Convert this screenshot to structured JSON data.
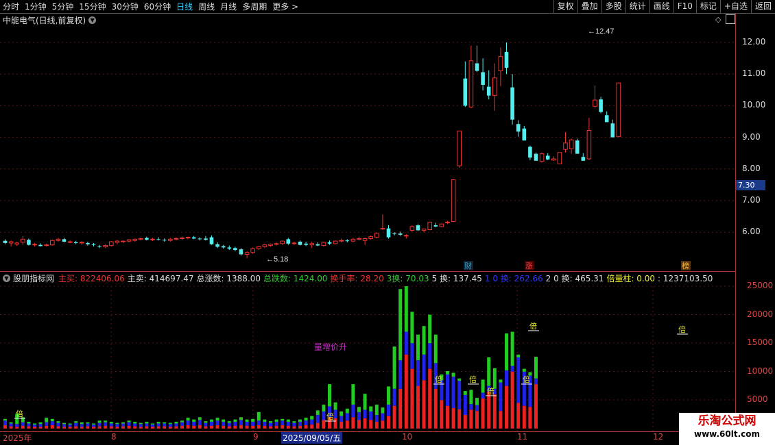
{
  "toolbar": {
    "tabs": [
      {
        "label": "分时",
        "active": false
      },
      {
        "label": "1分钟",
        "active": false
      },
      {
        "label": "5分钟",
        "active": false
      },
      {
        "label": "15分钟",
        "active": false
      },
      {
        "label": "30分钟",
        "active": false
      },
      {
        "label": "60分钟",
        "active": false
      },
      {
        "label": "日线",
        "active": true
      },
      {
        "label": "周线",
        "active": false
      },
      {
        "label": "月线",
        "active": false
      },
      {
        "label": "多周期",
        "active": false
      },
      {
        "label": "更多 >",
        "active": false
      }
    ],
    "right_buttons": [
      "复权",
      "叠加",
      "多股",
      "统计",
      "画线",
      "F10",
      "标记",
      "+自选",
      "返回"
    ]
  },
  "chart_title": "中能电气(日线,前复权)",
  "price_axis": [
    "12.00",
    "11.00",
    "10.00",
    "9.00",
    "8.00",
    "7.00",
    "6.00"
  ],
  "current_price": "7.30",
  "high_label": "12.47",
  "low_label": "5.18",
  "event_markers": [
    {
      "text": "财",
      "color": "#3ad"
    },
    {
      "text": "涨",
      "color": "#e44"
    },
    {
      "text": "榜",
      "color": "#fb3"
    }
  ],
  "indicator": {
    "name": "股朋指标网",
    "fields": [
      {
        "label": "主买: ",
        "value": "822406.06",
        "color": "#e33"
      },
      {
        "label": "主卖: ",
        "value": "414697.47",
        "color": "#ddd"
      },
      {
        "label": "总涨数: ",
        "value": "1388.00",
        "color": "#ddd"
      },
      {
        "label": "总跌数: ",
        "value": "1424.00",
        "color": "#3c3"
      },
      {
        "label": "换手率: ",
        "value": "28.20",
        "color": "#e33"
      },
      {
        "label": "3换: ",
        "value": "70.03",
        "color": "#3c3"
      },
      {
        "label": "5 换: ",
        "value": "137.45",
        "color": "#ddd"
      },
      {
        "label": "1 0 换: ",
        "value": "262.66",
        "color": "#33f"
      },
      {
        "label": "2 0 换: ",
        "value": "465.31",
        "color": "#ddd"
      },
      {
        "label": "倍量柱: ",
        "value": "0.00",
        "color": "#ee3"
      },
      {
        "label": ": ",
        "value": "1237103.50",
        "color": "#ddd"
      }
    ],
    "annotation": "量增价升",
    "bei_label": "倍"
  },
  "volume_axis": [
    "25000",
    "20000",
    "15000",
    "10000",
    "5000"
  ],
  "date_axis": [
    "2025年",
    "8",
    "9",
    "2025/09/05/五",
    "10",
    "11",
    "12"
  ],
  "watermark": {
    "line1": "乐淘公式网",
    "line2": "www.60lt.com"
  },
  "chart_data": {
    "type": "candlestick",
    "candles": [
      {
        "o": 5.73,
        "h": 5.78,
        "l": 5.62,
        "c": 5.66
      },
      {
        "o": 5.66,
        "h": 5.74,
        "l": 5.55,
        "c": 5.7
      },
      {
        "o": 5.62,
        "h": 5.7,
        "l": 5.57,
        "c": 5.66
      },
      {
        "o": 5.68,
        "h": 5.88,
        "l": 5.6,
        "c": 5.78
      },
      {
        "o": 5.76,
        "h": 5.8,
        "l": 5.58,
        "c": 5.6
      },
      {
        "o": 5.6,
        "h": 5.66,
        "l": 5.55,
        "c": 5.62
      },
      {
        "o": 5.6,
        "h": 5.65,
        "l": 5.55,
        "c": 5.56
      },
      {
        "o": 5.58,
        "h": 5.64,
        "l": 5.55,
        "c": 5.6
      },
      {
        "o": 5.6,
        "h": 5.76,
        "l": 5.58,
        "c": 5.74
      },
      {
        "o": 5.74,
        "h": 5.82,
        "l": 5.7,
        "c": 5.78
      },
      {
        "o": 5.78,
        "h": 5.82,
        "l": 5.68,
        "c": 5.7
      },
      {
        "o": 5.7,
        "h": 5.74,
        "l": 5.65,
        "c": 5.7
      },
      {
        "o": 5.68,
        "h": 5.73,
        "l": 5.62,
        "c": 5.66
      },
      {
        "o": 5.66,
        "h": 5.72,
        "l": 5.6,
        "c": 5.68
      },
      {
        "o": 5.66,
        "h": 5.7,
        "l": 5.58,
        "c": 5.62
      },
      {
        "o": 5.62,
        "h": 5.66,
        "l": 5.55,
        "c": 5.6
      },
      {
        "o": 5.56,
        "h": 5.6,
        "l": 5.5,
        "c": 5.54
      },
      {
        "o": 5.54,
        "h": 5.62,
        "l": 5.5,
        "c": 5.58
      },
      {
        "o": 5.58,
        "h": 5.72,
        "l": 5.55,
        "c": 5.7
      },
      {
        "o": 5.68,
        "h": 5.75,
        "l": 5.62,
        "c": 5.72
      },
      {
        "o": 5.7,
        "h": 5.74,
        "l": 5.66,
        "c": 5.72
      },
      {
        "o": 5.72,
        "h": 5.78,
        "l": 5.68,
        "c": 5.76
      },
      {
        "o": 5.74,
        "h": 5.8,
        "l": 5.7,
        "c": 5.78
      },
      {
        "o": 5.78,
        "h": 5.83,
        "l": 5.74,
        "c": 5.8
      },
      {
        "o": 5.82,
        "h": 5.86,
        "l": 5.74,
        "c": 5.76
      },
      {
        "o": 5.76,
        "h": 5.82,
        "l": 5.72,
        "c": 5.78
      },
      {
        "o": 5.78,
        "h": 5.84,
        "l": 5.74,
        "c": 5.76
      },
      {
        "o": 5.76,
        "h": 5.8,
        "l": 5.7,
        "c": 5.74
      },
      {
        "o": 5.74,
        "h": 5.82,
        "l": 5.7,
        "c": 5.78
      },
      {
        "o": 5.78,
        "h": 5.84,
        "l": 5.74,
        "c": 5.8
      },
      {
        "o": 5.8,
        "h": 5.86,
        "l": 5.76,
        "c": 5.82
      },
      {
        "o": 5.82,
        "h": 5.86,
        "l": 5.78,
        "c": 5.84
      },
      {
        "o": 5.84,
        "h": 5.88,
        "l": 5.78,
        "c": 5.8
      },
      {
        "o": 5.8,
        "h": 5.84,
        "l": 5.74,
        "c": 5.78
      },
      {
        "o": 5.8,
        "h": 5.88,
        "l": 5.74,
        "c": 5.76
      },
      {
        "o": 5.84,
        "h": 5.9,
        "l": 5.6,
        "c": 5.62
      },
      {
        "o": 5.62,
        "h": 5.68,
        "l": 5.5,
        "c": 5.54
      },
      {
        "o": 5.56,
        "h": 5.6,
        "l": 5.48,
        "c": 5.52
      },
      {
        "o": 5.52,
        "h": 5.58,
        "l": 5.44,
        "c": 5.48
      },
      {
        "o": 5.5,
        "h": 5.54,
        "l": 5.4,
        "c": 5.44
      },
      {
        "o": 5.46,
        "h": 5.5,
        "l": 5.26,
        "c": 5.3
      },
      {
        "o": 5.3,
        "h": 5.4,
        "l": 5.18,
        "c": 5.36
      },
      {
        "o": 5.36,
        "h": 5.52,
        "l": 5.32,
        "c": 5.48
      },
      {
        "o": 5.48,
        "h": 5.56,
        "l": 5.44,
        "c": 5.54
      },
      {
        "o": 5.54,
        "h": 5.62,
        "l": 5.5,
        "c": 5.6
      },
      {
        "o": 5.58,
        "h": 5.64,
        "l": 5.54,
        "c": 5.62
      },
      {
        "o": 5.62,
        "h": 5.68,
        "l": 5.58,
        "c": 5.64
      },
      {
        "o": 5.64,
        "h": 5.74,
        "l": 5.6,
        "c": 5.72
      },
      {
        "o": 5.78,
        "h": 5.82,
        "l": 5.6,
        "c": 5.64
      },
      {
        "o": 5.64,
        "h": 5.7,
        "l": 5.6,
        "c": 5.66
      },
      {
        "o": 5.7,
        "h": 5.74,
        "l": 5.58,
        "c": 5.6
      },
      {
        "o": 5.64,
        "h": 5.7,
        "l": 5.56,
        "c": 5.6
      },
      {
        "o": 5.6,
        "h": 5.7,
        "l": 5.5,
        "c": 5.64
      },
      {
        "o": 5.62,
        "h": 5.68,
        "l": 5.56,
        "c": 5.58
      },
      {
        "o": 5.58,
        "h": 5.7,
        "l": 5.55,
        "c": 5.68
      },
      {
        "o": 5.68,
        "h": 5.74,
        "l": 5.6,
        "c": 5.64
      },
      {
        "o": 5.64,
        "h": 5.74,
        "l": 5.62,
        "c": 5.72
      },
      {
        "o": 5.72,
        "h": 5.8,
        "l": 5.68,
        "c": 5.74
      },
      {
        "o": 5.74,
        "h": 5.78,
        "l": 5.68,
        "c": 5.72
      },
      {
        "o": 5.72,
        "h": 5.82,
        "l": 5.68,
        "c": 5.78
      },
      {
        "o": 5.78,
        "h": 5.86,
        "l": 5.74,
        "c": 5.8
      },
      {
        "o": 5.74,
        "h": 5.82,
        "l": 5.6,
        "c": 5.8
      },
      {
        "o": 5.8,
        "h": 5.9,
        "l": 5.76,
        "c": 5.86
      },
      {
        "o": 5.84,
        "h": 6.0,
        "l": 5.8,
        "c": 5.96
      },
      {
        "o": 6.12,
        "h": 6.56,
        "l": 6.08,
        "c": 6.12
      },
      {
        "o": 6.12,
        "h": 6.22,
        "l": 5.8,
        "c": 5.84
      },
      {
        "o": 5.96,
        "h": 6.0,
        "l": 5.9,
        "c": 5.94
      },
      {
        "o": 5.96,
        "h": 6.02,
        "l": 5.88,
        "c": 5.92
      },
      {
        "o": 5.9,
        "h": 5.94,
        "l": 5.8,
        "c": 5.9
      },
      {
        "o": 6.06,
        "h": 6.22,
        "l": 6.02,
        "c": 6.18
      },
      {
        "o": 6.22,
        "h": 6.26,
        "l": 6.04,
        "c": 6.06
      },
      {
        "o": 6.06,
        "h": 6.12,
        "l": 6.0,
        "c": 6.1
      },
      {
        "o": 6.08,
        "h": 6.34,
        "l": 6.06,
        "c": 6.32
      },
      {
        "o": 6.22,
        "h": 6.3,
        "l": 6.16,
        "c": 6.18
      },
      {
        "o": 6.18,
        "h": 6.28,
        "l": 6.16,
        "c": 6.26
      },
      {
        "o": 6.3,
        "h": 6.36,
        "l": 6.26,
        "c": 6.32
      },
      {
        "o": 6.34,
        "h": 7.66,
        "l": 6.34,
        "c": 7.66
      },
      {
        "o": 8.1,
        "h": 8.24,
        "l": 8.04,
        "c": 9.2
      },
      {
        "o": 10.86,
        "h": 11.4,
        "l": 9.96,
        "c": 10.0
      },
      {
        "o": 9.96,
        "h": 11.9,
        "l": 9.92,
        "c": 11.42
      },
      {
        "o": 11.34,
        "h": 11.9,
        "l": 11.06,
        "c": 11.1
      },
      {
        "o": 11.06,
        "h": 11.5,
        "l": 10.48,
        "c": 10.66
      },
      {
        "o": 10.6,
        "h": 11.12,
        "l": 10.2,
        "c": 10.32
      },
      {
        "o": 10.32,
        "h": 11.34,
        "l": 9.84,
        "c": 10.88
      },
      {
        "o": 11.1,
        "h": 11.84,
        "l": 10.62,
        "c": 11.56
      },
      {
        "o": 11.7,
        "h": 12.0,
        "l": 11.0,
        "c": 11.2
      },
      {
        "o": 10.58,
        "h": 11.0,
        "l": 9.4,
        "c": 9.56
      },
      {
        "o": 9.42,
        "h": 9.54,
        "l": 9.02,
        "c": 9.18
      },
      {
        "o": 9.28,
        "h": 9.36,
        "l": 8.9,
        "c": 8.9
      },
      {
        "o": 8.7,
        "h": 8.74,
        "l": 8.28,
        "c": 8.36
      },
      {
        "o": 8.48,
        "h": 8.52,
        "l": 8.26,
        "c": 8.26
      },
      {
        "o": 8.24,
        "h": 8.52,
        "l": 8.2,
        "c": 8.48
      },
      {
        "o": 8.42,
        "h": 8.5,
        "l": 8.28,
        "c": 8.3
      },
      {
        "o": 8.28,
        "h": 8.4,
        "l": 8.26,
        "c": 8.32
      },
      {
        "o": 8.16,
        "h": 8.5,
        "l": 8.16,
        "c": 8.52
      },
      {
        "o": 8.62,
        "h": 9.16,
        "l": 8.52,
        "c": 8.82
      },
      {
        "o": 8.64,
        "h": 8.96,
        "l": 8.48,
        "c": 8.92
      },
      {
        "o": 8.9,
        "h": 8.96,
        "l": 8.48,
        "c": 8.48
      },
      {
        "o": 8.38,
        "h": 8.5,
        "l": 8.26,
        "c": 8.26
      },
      {
        "o": 8.32,
        "h": 9.62,
        "l": 8.28,
        "c": 9.22
      },
      {
        "o": 9.98,
        "h": 10.64,
        "l": 9.94,
        "c": 10.18
      },
      {
        "o": 10.2,
        "h": 10.28,
        "l": 9.76,
        "c": 9.8
      },
      {
        "o": 9.7,
        "h": 9.82,
        "l": 9.48,
        "c": 9.48
      },
      {
        "o": 9.44,
        "h": 9.56,
        "l": 9.0,
        "c": 9.0
      },
      {
        "o": 9.02,
        "h": 10.72,
        "l": 9.02,
        "c": 10.72
      }
    ],
    "volume": [
      {
        "r": 600,
        "b": 800,
        "g": 300
      },
      {
        "r": 400,
        "b": 500,
        "g": 200
      },
      {
        "r": 300,
        "b": 500,
        "g": 1800
      },
      {
        "r": 500,
        "b": 600,
        "g": 900
      },
      {
        "r": 400,
        "b": 500,
        "g": 300
      },
      {
        "r": 300,
        "b": 400,
        "g": 200
      },
      {
        "r": 300,
        "b": 500,
        "g": 300
      },
      {
        "r": 500,
        "b": 600,
        "g": 800
      },
      {
        "r": 600,
        "b": 700,
        "g": 400
      },
      {
        "r": 400,
        "b": 600,
        "g": 300
      },
      {
        "r": 300,
        "b": 500,
        "g": 200
      },
      {
        "r": 300,
        "b": 400,
        "g": 200
      },
      {
        "r": 400,
        "b": 600,
        "g": 300
      },
      {
        "r": 300,
        "b": 500,
        "g": 300
      },
      {
        "r": 400,
        "b": 500,
        "g": 200
      },
      {
        "r": 300,
        "b": 400,
        "g": 200
      },
      {
        "r": 400,
        "b": 600,
        "g": 400
      },
      {
        "r": 500,
        "b": 600,
        "g": 300
      },
      {
        "r": 400,
        "b": 500,
        "g": 300
      },
      {
        "r": 300,
        "b": 500,
        "g": 200
      },
      {
        "r": 400,
        "b": 500,
        "g": 200
      },
      {
        "r": 500,
        "b": 600,
        "g": 300
      },
      {
        "r": 400,
        "b": 500,
        "g": 300
      },
      {
        "r": 300,
        "b": 500,
        "g": 200
      },
      {
        "r": 400,
        "b": 500,
        "g": 300
      },
      {
        "r": 300,
        "b": 400,
        "g": 200
      },
      {
        "r": 400,
        "b": 500,
        "g": 300
      },
      {
        "r": 400,
        "b": 500,
        "g": 200
      },
      {
        "r": 300,
        "b": 500,
        "g": 200
      },
      {
        "r": 400,
        "b": 500,
        "g": 300
      },
      {
        "r": 500,
        "b": 600,
        "g": 300
      },
      {
        "r": 600,
        "b": 800,
        "g": 500
      },
      {
        "r": 500,
        "b": 700,
        "g": 400
      },
      {
        "r": 600,
        "b": 900,
        "g": 500
      },
      {
        "r": 400,
        "b": 600,
        "g": 300
      },
      {
        "r": 500,
        "b": 700,
        "g": 400
      },
      {
        "r": 600,
        "b": 800,
        "g": 500
      },
      {
        "r": 500,
        "b": 700,
        "g": 400
      },
      {
        "r": 400,
        "b": 600,
        "g": 300
      },
      {
        "r": 500,
        "b": 700,
        "g": 400
      },
      {
        "r": 600,
        "b": 900,
        "g": 500
      },
      {
        "r": 500,
        "b": 700,
        "g": 400
      },
      {
        "r": 500,
        "b": 700,
        "g": 500
      },
      {
        "r": 600,
        "b": 800,
        "g": 1500
      },
      {
        "r": 500,
        "b": 700,
        "g": 400
      },
      {
        "r": 400,
        "b": 600,
        "g": 300
      },
      {
        "r": 500,
        "b": 700,
        "g": 400
      },
      {
        "r": 600,
        "b": 800,
        "g": 300
      },
      {
        "r": 500,
        "b": 700,
        "g": 400
      },
      {
        "r": 400,
        "b": 600,
        "g": 300
      },
      {
        "r": 500,
        "b": 700,
        "g": 400
      },
      {
        "r": 600,
        "b": 800,
        "g": 500
      },
      {
        "r": 700,
        "b": 900,
        "g": 600
      },
      {
        "r": 1000,
        "b": 1400,
        "g": 800
      },
      {
        "r": 1500,
        "b": 1500,
        "g": 1200
      },
      {
        "r": 2000,
        "b": 1900,
        "g": 3900
      },
      {
        "r": 1800,
        "b": 1500,
        "g": 1300
      },
      {
        "r": 1200,
        "b": 1000,
        "g": 800
      },
      {
        "r": 1400,
        "b": 1300,
        "g": 800
      },
      {
        "r": 2000,
        "b": 2200,
        "g": 3600
      },
      {
        "r": 1500,
        "b": 1400,
        "g": 900
      },
      {
        "r": 1800,
        "b": 1500,
        "g": 2800
      },
      {
        "r": 1500,
        "b": 1500,
        "g": 900
      },
      {
        "r": 1200,
        "b": 1200,
        "g": 1800
      },
      {
        "r": 1400,
        "b": 1300,
        "g": 1000
      },
      {
        "r": 2200,
        "b": 2000,
        "g": 3200
      },
      {
        "r": 4000,
        "b": 3000,
        "g": 7400
      },
      {
        "r": 7000,
        "b": 5000,
        "g": 12500
      },
      {
        "r": 13000,
        "b": 4000,
        "g": 8000
      },
      {
        "r": 10500,
        "b": 4500,
        "g": 5500
      },
      {
        "r": 7500,
        "b": 4500,
        "g": 4500
      },
      {
        "r": 8500,
        "b": 4500,
        "g": 5000
      },
      {
        "r": 10500,
        "b": 4500,
        "g": 5000
      },
      {
        "r": 7000,
        "b": 4500,
        "g": 5000
      },
      {
        "r": 5000,
        "b": 3500,
        "g": 1000
      },
      {
        "r": 4000,
        "b": 5500,
        "g": 600
      },
      {
        "r": 3600,
        "b": 5500,
        "g": 700
      },
      {
        "r": 3400,
        "b": 5000,
        "g": 400
      },
      {
        "r": 2400,
        "b": 3500,
        "g": 700
      },
      {
        "r": 3300,
        "b": 1000,
        "g": 2500
      },
      {
        "r": 3100,
        "b": 1000,
        "g": 1300
      },
      {
        "r": 5300,
        "b": 1000,
        "g": 2300
      },
      {
        "r": 6500,
        "b": 1000,
        "g": 5000
      },
      {
        "r": 6000,
        "b": 1000,
        "g": 3600
      },
      {
        "r": 3100,
        "b": 5000,
        "g": 500
      },
      {
        "r": 7500,
        "b": 2700,
        "g": 6500
      },
      {
        "r": 10000,
        "b": 1000,
        "g": 6000
      },
      {
        "r": 4500,
        "b": 8000,
        "g": 500
      },
      {
        "r": 4000,
        "b": 6000,
        "g": 500
      },
      {
        "r": 3800,
        "b": 5500,
        "g": 600
      },
      {
        "r": 7800,
        "b": 1000,
        "g": 3800
      }
    ]
  }
}
